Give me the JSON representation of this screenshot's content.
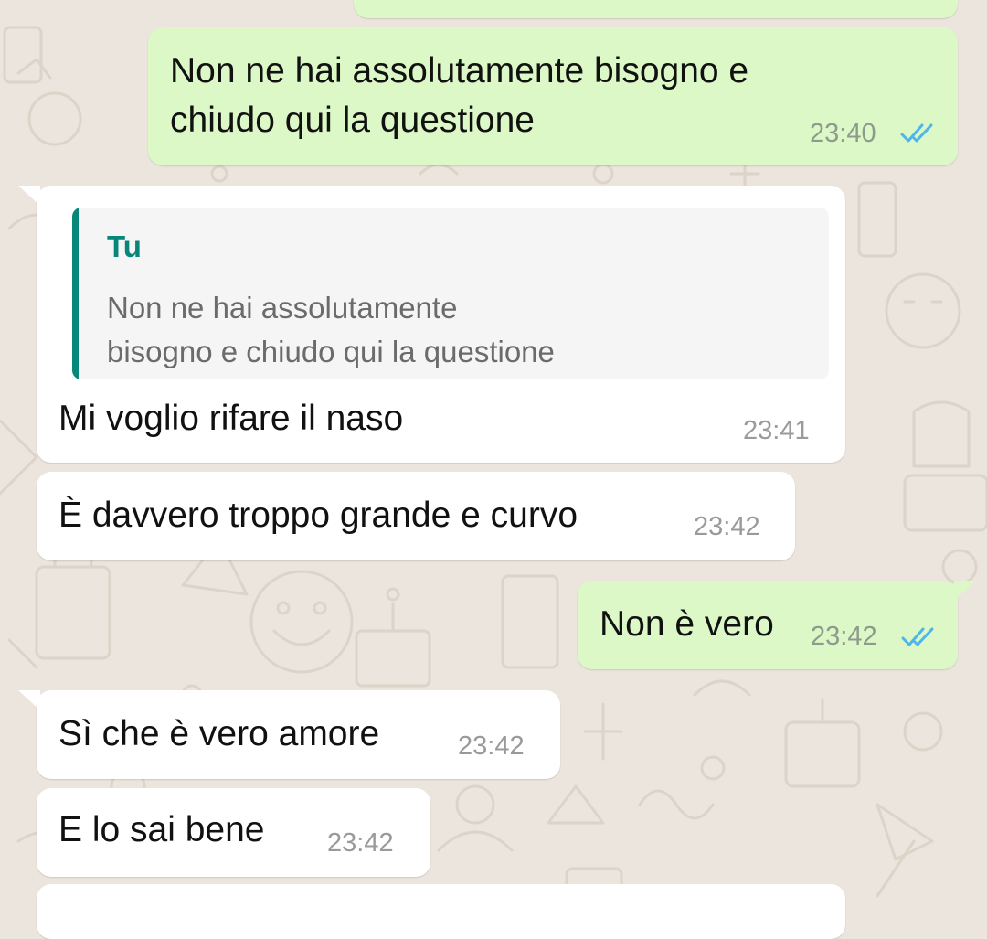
{
  "colors": {
    "outgoing_bubble": "#dcf8c6",
    "incoming_bubble": "#ffffff",
    "wallpaper": "#ece5dd",
    "quote_accent": "#07867a",
    "read_ticks": "#4fb6ec"
  },
  "messages": [
    {
      "direction": "out",
      "text_line1": "Non ne hai assolutamente bisogno e",
      "text_line2": "chiudo qui la questione",
      "time": "23:40",
      "status_icon": "double-check-read-icon"
    },
    {
      "direction": "in",
      "reply_to": {
        "author": "Tu",
        "text_line1": "Non ne hai assolutamente",
        "text_line2": "bisogno e chiudo qui la questione"
      },
      "text": "Mi voglio rifare il naso",
      "time": "23:41"
    },
    {
      "direction": "in",
      "text": "È davvero troppo grande e curvo",
      "time": "23:42"
    },
    {
      "direction": "out",
      "text": "Non è vero",
      "time": "23:42",
      "status_icon": "double-check-read-icon"
    },
    {
      "direction": "in",
      "text": "Sì che è vero amore",
      "time": "23:42"
    },
    {
      "direction": "in",
      "text": "E lo sai bene",
      "time": "23:42"
    }
  ]
}
